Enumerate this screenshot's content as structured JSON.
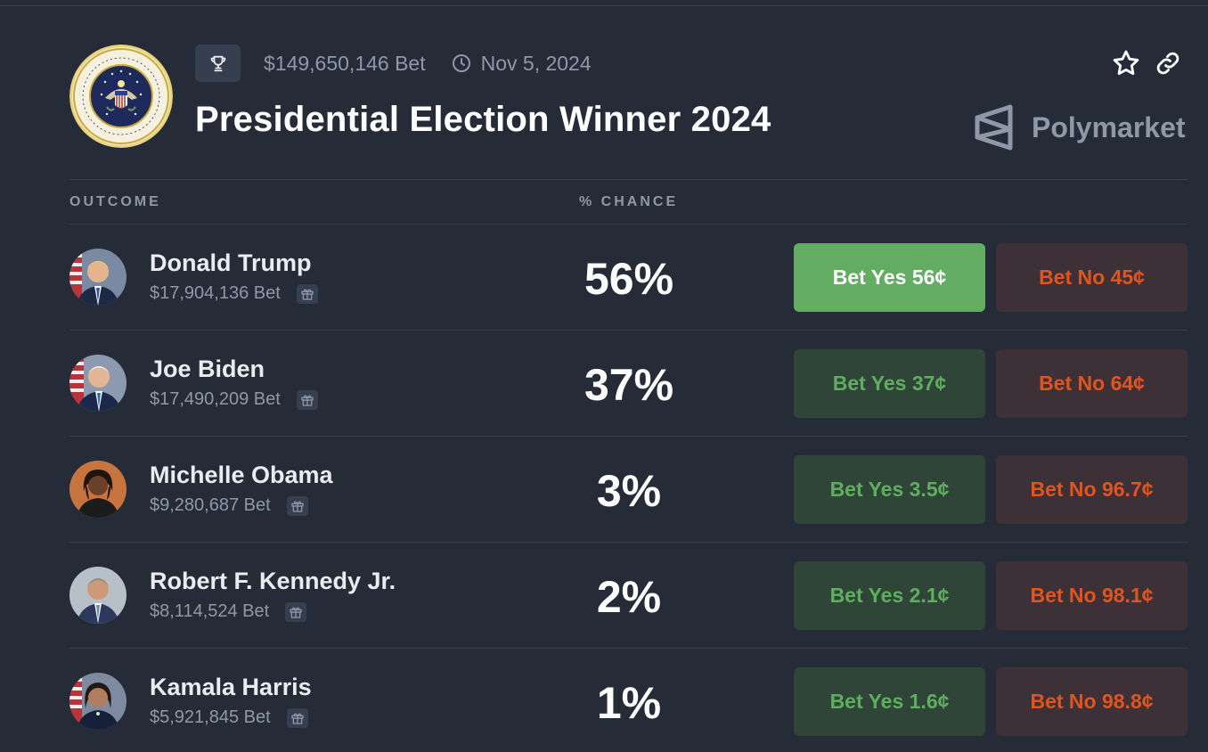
{
  "market": {
    "volume": "$149,650,146 Bet",
    "date": "Nov 5, 2024",
    "title": "Presidential Election Winner 2024",
    "brand": "Polymarket"
  },
  "table": {
    "outcome_header": "OUTCOME",
    "chance_header": "% CHANCE"
  },
  "outcomes": [
    {
      "name": "Donald Trump",
      "volume": "$17,904,136 Bet",
      "chance": "56%",
      "yes": "Bet Yes 56¢",
      "no": "Bet No 45¢"
    },
    {
      "name": "Joe Biden",
      "volume": "$17,490,209 Bet",
      "chance": "37%",
      "yes": "Bet Yes 37¢",
      "no": "Bet No 64¢"
    },
    {
      "name": "Michelle Obama",
      "volume": "$9,280,687 Bet",
      "chance": "3%",
      "yes": "Bet Yes 3.5¢",
      "no": "Bet No 96.7¢"
    },
    {
      "name": "Robert F. Kennedy Jr.",
      "volume": "$8,114,524 Bet",
      "chance": "2%",
      "yes": "Bet Yes 2.1¢",
      "no": "Bet No 98.1¢"
    },
    {
      "name": "Kamala Harris",
      "volume": "$5,921,845 Bet",
      "chance": "1%",
      "yes": "Bet Yes 1.6¢",
      "no": "Bet No 98.8¢"
    }
  ],
  "icons": {
    "trophy": "trophy-icon",
    "clock": "clock-icon",
    "star": "star-icon",
    "link": "link-icon",
    "gift": "gift-icon",
    "brand_logo": "polymarket-logo-icon"
  },
  "colors": {
    "background": "#252c38",
    "yes_active": "#63ad63",
    "yes_bg": "#2f4538",
    "yes_text": "#5fad5f",
    "no_bg": "#3d3037",
    "no_text": "#e0541e",
    "muted": "#8f98a6"
  }
}
